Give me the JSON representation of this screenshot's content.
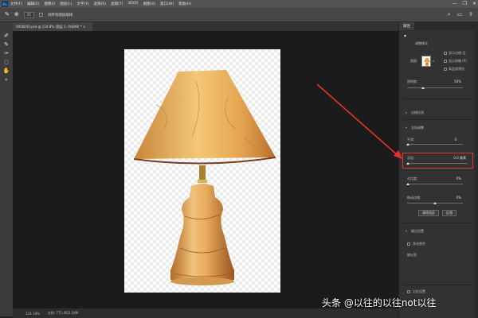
{
  "menubar": {
    "logo": "Ps",
    "items": [
      "文件(F)",
      "编辑(E)",
      "图像(I)",
      "图层(L)",
      "文字(Y)",
      "选择(S)",
      "滤镜(T)",
      "3D(D)",
      "视图(V)",
      "窗口(W)",
      "帮助(H)"
    ],
    "controls": [
      "—",
      "❐",
      "✕"
    ]
  },
  "options": {
    "size_value": "25",
    "checkbox_label": "对所有图层取样"
  },
  "document": {
    "tab_label": "0056050.psd @ 124.8% (图层 1, RGB/8) *",
    "tab_close": "×"
  },
  "status": {
    "zoom": "124.18%",
    "doc_info": "文档: 771.4K/2.34M"
  },
  "panel": {
    "tab": "属性",
    "section_title": "调整模式",
    "view_label": "视图:",
    "check_show_edge": "显示边缘 (J)",
    "check_show_original": "显示原稿 (P)",
    "check_hq_preview": "高品质预览",
    "opacity_label": "透明度:",
    "opacity_value": "50%",
    "edge_detection": "边缘检测",
    "global_refine": "全局调整",
    "smooth_label": "平滑:",
    "smooth_value": "0",
    "feather_label": "羽化:",
    "feather_value": "0.0 像素",
    "contrast_label": "对比度:",
    "contrast_value": "0%",
    "shift_edge_label": "移动边缘:",
    "shift_edge_value": "0%",
    "clear_selection": "清除选区",
    "invert": "反相",
    "output_settings": "输出设置",
    "decontaminate": "净化颜色",
    "output_to": "输出到",
    "remember_settings": "记住设置"
  },
  "watermark": "头条 @以往的以往not以往",
  "colors": {
    "highlight": "#e0342d",
    "arrow": "#e0342d"
  }
}
